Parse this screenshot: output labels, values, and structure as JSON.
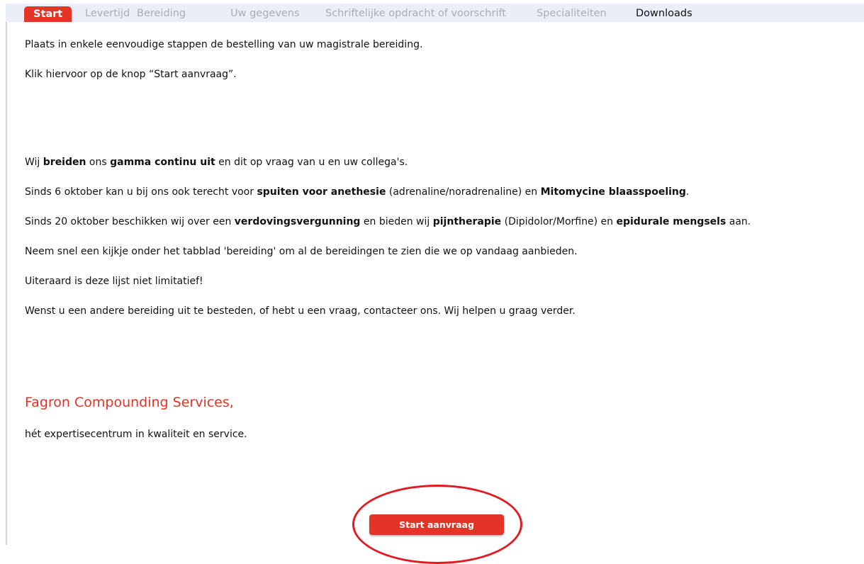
{
  "tabs": [
    "Start",
    "Levertijd",
    "Bereiding",
    "Uw gegevens",
    "Schriftelijke opdracht of voorschrift",
    "Specialiteiten",
    "Downloads"
  ],
  "intro": {
    "line1": "Plaats in enkele eenvoudige stappen de bestelling van uw magistrale bereiding.",
    "line2": "Klik hiervoor op de knop “Start aanvraag”."
  },
  "p1": {
    "a": "Wij ",
    "b1": "breiden",
    "c": " ons ",
    "b2": "gamma continu uit",
    "d": " en dit op vraag van u en uw collega's."
  },
  "p2": {
    "a": "Sinds 6 oktober kan u bij ons ook terecht voor ",
    "b1": "spuiten voor anethesie",
    "c": " (adrenaline/noradrenaline) en ",
    "b2": "Mitomycine blaasspoeling",
    "d": "."
  },
  "p3": {
    "a": "Sinds 20 oktober beschikken wij over een ",
    "b1": "verdovingsvergunning",
    "c": " en bieden wij ",
    "b2": "pijntherapie",
    "d": " (Dipidolor/Morfine) en ",
    "b3": "epidurale mengsels",
    "e": " aan."
  },
  "p4": "Neem snel een kijkje onder het tabblad 'bereiding' om al de bereidingen te zien die we op vandaag aanbieden.",
  "p5": "Uiteraard is deze lijst niet limitatief!",
  "p6": "Wenst u een andere bereiding uit te besteden, of hebt u een vraag, contacteer ons. Wij helpen u graag verder.",
  "brand": "Fagron Compounding Services,",
  "tagline": "hét expertisecentrum in kwaliteit en service.",
  "button": "Start aanvraag",
  "colors": {
    "accent": "#e53327",
    "tabbar": "#e9eef8",
    "annotation": "#e11b22"
  }
}
